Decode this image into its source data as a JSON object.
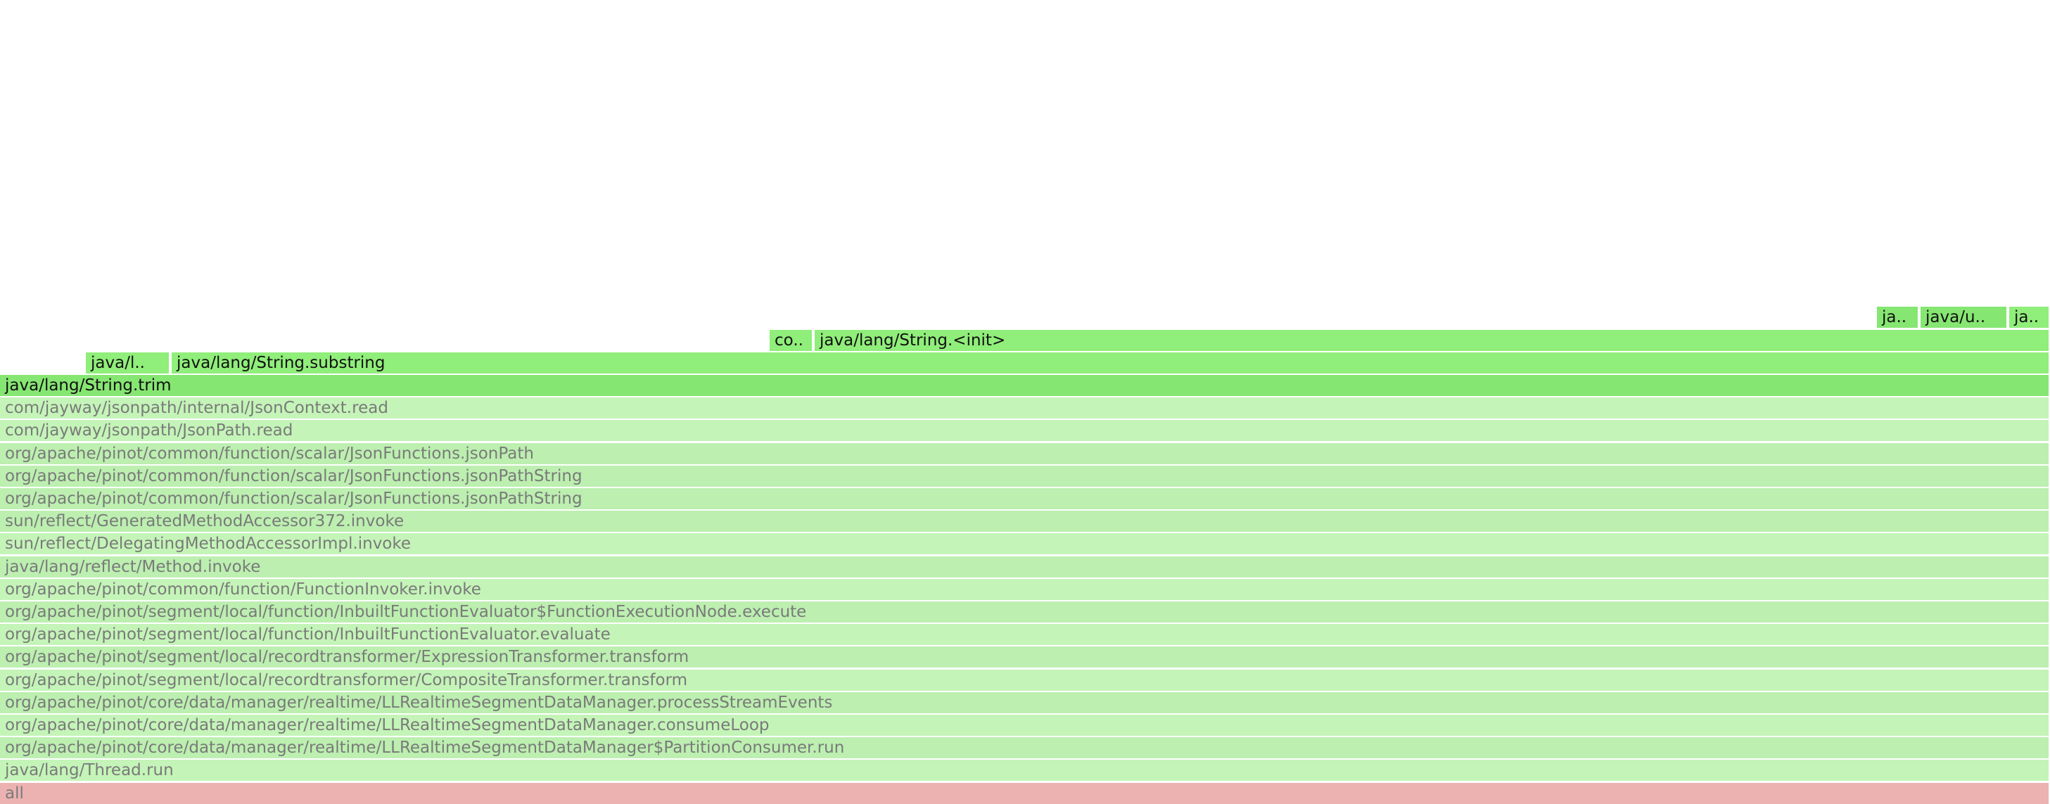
{
  "colors": {
    "dim_light": "#c4f4b8",
    "dim_mid": "#bcefb0",
    "hot_light": "#90ee7a",
    "hot_mid": "#86e672",
    "root": "#ecb2b2"
  },
  "frames": [
    {
      "label": "all",
      "tone": "root"
    },
    {
      "label": "java/lang/Thread.run",
      "tone": "dim_light"
    },
    {
      "label": "org/apache/pinot/core/data/manager/realtime/LLRealtimeSegmentDataManager$PartitionConsumer.run",
      "tone": "dim_mid"
    },
    {
      "label": "org/apache/pinot/core/data/manager/realtime/LLRealtimeSegmentDataManager.consumeLoop",
      "tone": "dim_light"
    },
    {
      "label": "org/apache/pinot/core/data/manager/realtime/LLRealtimeSegmentDataManager.processStreamEvents",
      "tone": "dim_mid"
    },
    {
      "label": "org/apache/pinot/segment/local/recordtransformer/CompositeTransformer.transform",
      "tone": "dim_light"
    },
    {
      "label": "org/apache/pinot/segment/local/recordtransformer/ExpressionTransformer.transform",
      "tone": "dim_mid"
    },
    {
      "label": "org/apache/pinot/segment/local/function/InbuiltFunctionEvaluator.evaluate",
      "tone": "dim_light"
    },
    {
      "label": "org/apache/pinot/segment/local/function/InbuiltFunctionEvaluator$FunctionExecutionNode.execute",
      "tone": "dim_mid"
    },
    {
      "label": "org/apache/pinot/common/function/FunctionInvoker.invoke",
      "tone": "dim_light"
    },
    {
      "label": "java/lang/reflect/Method.invoke",
      "tone": "dim_mid"
    },
    {
      "label": "sun/reflect/DelegatingMethodAccessorImpl.invoke",
      "tone": "dim_light"
    },
    {
      "label": "sun/reflect/GeneratedMethodAccessor372.invoke",
      "tone": "dim_mid"
    },
    {
      "label": "org/apache/pinot/common/function/scalar/JsonFunctions.jsonPathString",
      "tone": "dim_mid"
    },
    {
      "label": "org/apache/pinot/common/function/scalar/JsonFunctions.jsonPathString",
      "tone": "dim_mid"
    },
    {
      "label": "org/apache/pinot/common/function/scalar/JsonFunctions.jsonPath",
      "tone": "dim_mid"
    },
    {
      "label": "com/jayway/jsonpath/JsonPath.read",
      "tone": "dim_light"
    },
    {
      "label": "com/jayway/jsonpath/internal/JsonContext.read",
      "tone": "dim_light"
    },
    {
      "label": "java/lang/String.trim",
      "tone": "hot_mid"
    },
    {
      "label": "java/l..",
      "tone": "hot_light"
    },
    {
      "label": "java/lang/String.substring",
      "tone": "hot_light"
    },
    {
      "label": "co..",
      "tone": "hot_light"
    },
    {
      "label": "java/lang/String.<init>",
      "tone": "hot_light"
    },
    {
      "label": "ja..",
      "tone": "hot_mid"
    },
    {
      "label": "java/u..",
      "tone": "hot_mid"
    },
    {
      "label": "ja..",
      "tone": "hot_light"
    }
  ]
}
